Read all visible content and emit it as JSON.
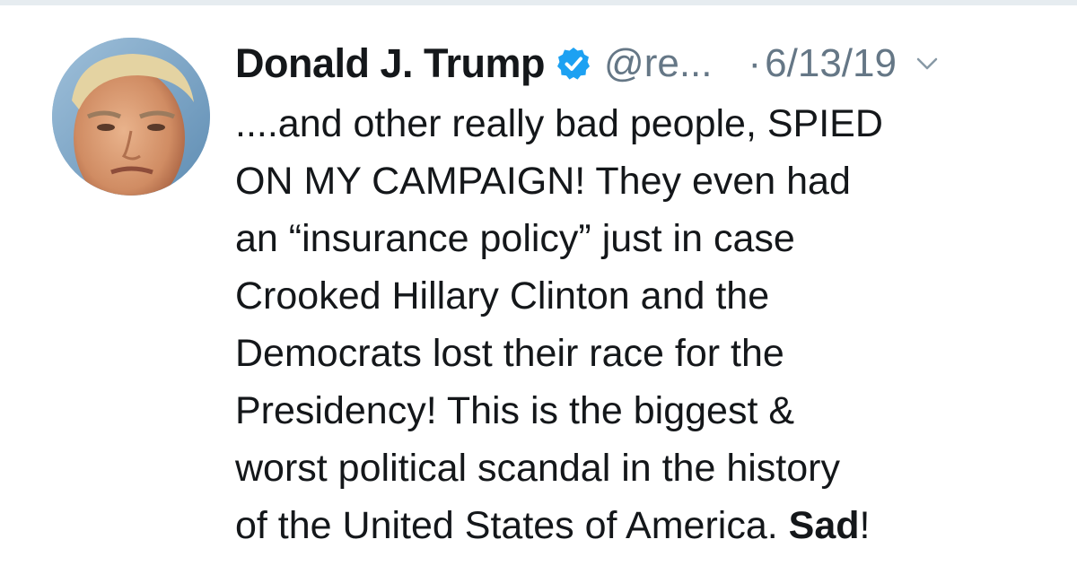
{
  "tweet": {
    "display_name": "Donald J. Trump",
    "handle": "@re...",
    "separator": "·",
    "timestamp": "6/13/19",
    "icons": {
      "avatar": "profile-photo",
      "verified": "verified-badge-icon",
      "menu": "chevron-down-icon"
    },
    "colors": {
      "verified": "#1da1f2",
      "meta_text": "#657786",
      "body_text": "#14171a"
    },
    "body_lines": [
      "....and other really bad people, SPIED",
      "ON MY CAMPAIGN! They even had",
      "an “insurance policy” just in case",
      "Crooked Hillary Clinton and the",
      "Democrats lost their race for the",
      "Presidency! This is the biggest &",
      "worst political scandal in the history"
    ],
    "last_line_plain": "of the United States of America. ",
    "last_line_bold": "Sad",
    "last_line_end": "!"
  }
}
